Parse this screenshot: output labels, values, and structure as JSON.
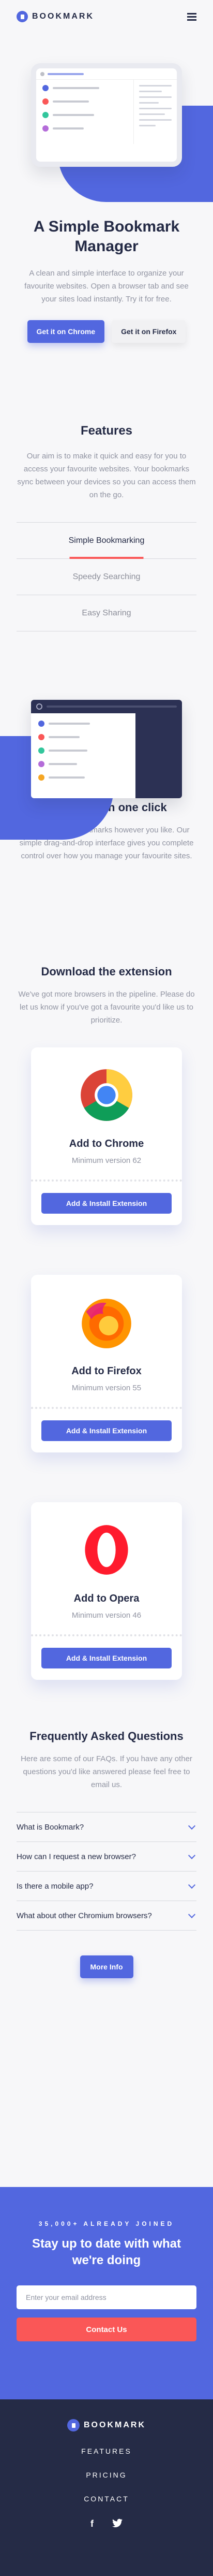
{
  "brand": {
    "name": "BOOKMARK"
  },
  "hero": {
    "title": "A Simple Bookmark Manager",
    "text": "A clean and simple interface to organize your favourite websites. Open a browser tab and see your sites load instantly. Try it for free.",
    "cta_chrome": "Get it on Chrome",
    "cta_firefox": "Get it on Firefox"
  },
  "features": {
    "title": "Features",
    "text": "Our aim is to make it quick and easy for you to access your favourite websites. Your bookmarks sync between your devices so you can access them on the go.",
    "tabs": [
      "Simple Bookmarking",
      "Speedy Searching",
      "Easy Sharing"
    ],
    "active_title": "Bookmark in one click",
    "active_text": "Organize your bookmarks however you like. Our simple drag-and-drop interface gives you complete control over how you manage your favourite sites."
  },
  "download": {
    "title": "Download the extension",
    "text": "We've got more browsers in the pipeline. Please do let us know if you've got a favourite you'd like us to prioritize.",
    "cards": [
      {
        "name": "Add to Chrome",
        "min": "Minimum version 62",
        "button": "Add & Install Extension"
      },
      {
        "name": "Add to Firefox",
        "min": "Minimum version 55",
        "button": "Add & Install Extension"
      },
      {
        "name": "Add to Opera",
        "min": "Minimum version 46",
        "button": "Add & Install Extension"
      }
    ]
  },
  "faq": {
    "title": "Frequently Asked Questions",
    "text": "Here are some of our FAQs. If you have any other questions you'd like answered please feel free to email us.",
    "items": [
      "What is Bookmark?",
      "How can I request a new browser?",
      "Is there a mobile app?",
      "What about other Chromium browsers?"
    ],
    "more": "More Info"
  },
  "newsletter": {
    "joined": "35,000+ ALREADY JOINED",
    "title": "Stay up to date with what we're doing",
    "placeholder": "Enter your email address",
    "button": "Contact Us"
  },
  "footer": {
    "nav": [
      "FEATURES",
      "PRICING",
      "CONTACT"
    ],
    "social": [
      "facebook-icon",
      "twitter-icon"
    ]
  },
  "colors": {
    "primary": "#5267df",
    "accent": "#fa5757",
    "dark": "#242a45",
    "footer": "#252b46"
  }
}
